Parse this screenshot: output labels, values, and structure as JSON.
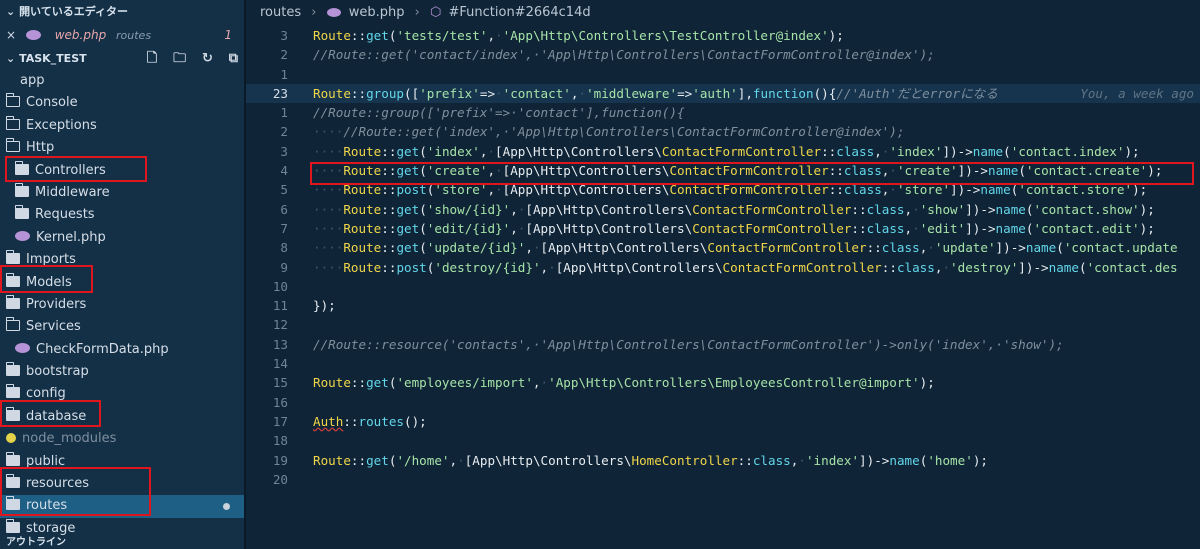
{
  "sidebar": {
    "open_editors_label": "開いているエディター",
    "open_editor": {
      "close": "×",
      "file": "web.php",
      "dir": "routes",
      "count": "1"
    },
    "project_label": "TASK_TEST",
    "tree": [
      {
        "label": "app",
        "level": 0,
        "type": "none"
      },
      {
        "label": "Console",
        "level": 1,
        "type": "folder"
      },
      {
        "label": "Exceptions",
        "level": 1,
        "type": "folder"
      },
      {
        "label": "Http",
        "level": 1,
        "type": "folder-open"
      },
      {
        "label": "Controllers",
        "level": 2,
        "type": "folder-filled"
      },
      {
        "label": "Middleware",
        "level": 2,
        "type": "folder-filled"
      },
      {
        "label": "Requests",
        "level": 2,
        "type": "folder-filled"
      },
      {
        "label": "Kernel.php",
        "level": 2,
        "type": "php"
      },
      {
        "label": "Imports",
        "level": 1,
        "type": "folder-filled"
      },
      {
        "label": "Models",
        "level": 1,
        "type": "folder-filled"
      },
      {
        "label": "Providers",
        "level": 1,
        "type": "folder-filled"
      },
      {
        "label": "Services",
        "level": 1,
        "type": "folder"
      },
      {
        "label": "CheckFormData.php",
        "level": 2,
        "type": "php"
      },
      {
        "label": "bootstrap",
        "level": 0,
        "type": "folder-filled"
      },
      {
        "label": "config",
        "level": 0,
        "type": "folder-filled"
      },
      {
        "label": "database",
        "level": 0,
        "type": "folder-filled"
      },
      {
        "label": "node_modules",
        "level": 0,
        "type": "node",
        "muted": true
      },
      {
        "label": "public",
        "level": 0,
        "type": "folder-filled"
      },
      {
        "label": "resources",
        "level": 0,
        "type": "folder-filled"
      },
      {
        "label": "routes",
        "level": 0,
        "type": "folder-filled",
        "active": true
      },
      {
        "label": "storage",
        "level": 0,
        "type": "folder-filled"
      }
    ],
    "outline_label": "アウトライン"
  },
  "breadcrumb": {
    "folder": "routes",
    "file": "web.php",
    "symbol": "#Function#2664c14d"
  },
  "code": {
    "blame": "You, a week ago",
    "lines": [
      {
        "n": "3",
        "segs": [
          [
            "y",
            "Route"
          ],
          [
            "w",
            "::"
          ],
          [
            "c",
            "get"
          ],
          [
            "w",
            "("
          ],
          [
            "s",
            "'tests/test'"
          ],
          [
            "w",
            ","
          ],
          [
            "x",
            "·"
          ],
          [
            "s",
            "'App\\Http\\Controllers\\TestController@index'"
          ],
          [
            "w",
            ");"
          ]
        ]
      },
      {
        "n": "2",
        "segs": [
          [
            "m",
            "//Route::get('contact/index',·'App\\Http\\Controllers\\ContactFormController@index');"
          ]
        ]
      },
      {
        "n": "1",
        "segs": []
      },
      {
        "n": "23",
        "current": true,
        "blame": true,
        "segs": [
          [
            "y",
            "Route"
          ],
          [
            "w",
            "::"
          ],
          [
            "c",
            "group"
          ],
          [
            "w",
            "(["
          ],
          [
            "s",
            "'prefix'"
          ],
          [
            "w",
            "=>"
          ],
          [
            "x",
            "·"
          ],
          [
            "s",
            "'contact'"
          ],
          [
            "w",
            ","
          ],
          [
            "x",
            "·"
          ],
          [
            "s",
            "'middleware'"
          ],
          [
            "w",
            "=>"
          ],
          [
            "s",
            "'auth'"
          ],
          [
            "w",
            "],"
          ],
          [
            "c",
            "function"
          ],
          [
            "w",
            "(){"
          ],
          [
            "m",
            "//'Auth'だとerrorになる"
          ]
        ]
      },
      {
        "n": "1",
        "segs": [
          [
            "m",
            "//Route::group(['prefix'=>·'contact'],function(){"
          ]
        ]
      },
      {
        "n": "2",
        "segs": [
          [
            "x",
            "····"
          ],
          [
            "m",
            "//Route::get('index',·'App\\Http\\Controllers\\ContactFormController@index');"
          ]
        ]
      },
      {
        "n": "3",
        "segs": [
          [
            "x",
            "····"
          ],
          [
            "y",
            "Route"
          ],
          [
            "w",
            "::"
          ],
          [
            "c",
            "get"
          ],
          [
            "w",
            "("
          ],
          [
            "s",
            "'index'"
          ],
          [
            "w",
            ","
          ],
          [
            "x",
            "·"
          ],
          [
            "w",
            "[App\\Http\\Controllers\\"
          ],
          [
            "y",
            "ContactFormController"
          ],
          [
            "w",
            "::"
          ],
          [
            "c",
            "class"
          ],
          [
            "w",
            ","
          ],
          [
            "x",
            "·"
          ],
          [
            "s",
            "'index'"
          ],
          [
            "w",
            "])->"
          ],
          [
            "c",
            "name"
          ],
          [
            "w",
            "("
          ],
          [
            "s",
            "'contact.index'"
          ],
          [
            "w",
            ");"
          ]
        ]
      },
      {
        "n": "4",
        "segs": [
          [
            "x",
            "····"
          ],
          [
            "y",
            "Route"
          ],
          [
            "w",
            "::"
          ],
          [
            "c",
            "get"
          ],
          [
            "w",
            "("
          ],
          [
            "s",
            "'create'"
          ],
          [
            "w",
            ","
          ],
          [
            "x",
            "·"
          ],
          [
            "w",
            "[App\\Http\\Controllers\\"
          ],
          [
            "y",
            "ContactFormController"
          ],
          [
            "w",
            "::"
          ],
          [
            "c",
            "class"
          ],
          [
            "w",
            ","
          ],
          [
            "x",
            "·"
          ],
          [
            "s",
            "'create'"
          ],
          [
            "w",
            "])->"
          ],
          [
            "c",
            "name"
          ],
          [
            "w",
            "("
          ],
          [
            "s",
            "'contact.create'"
          ],
          [
            "w",
            ");"
          ]
        ]
      },
      {
        "n": "5",
        "segs": [
          [
            "x",
            "····"
          ],
          [
            "y",
            "Route"
          ],
          [
            "w",
            "::"
          ],
          [
            "c",
            "post"
          ],
          [
            "w",
            "("
          ],
          [
            "s",
            "'store'"
          ],
          [
            "w",
            ","
          ],
          [
            "x",
            "·"
          ],
          [
            "w",
            "[App\\Http\\Controllers\\"
          ],
          [
            "y",
            "ContactFormController"
          ],
          [
            "w",
            "::"
          ],
          [
            "c",
            "class"
          ],
          [
            "w",
            ","
          ],
          [
            "x",
            "·"
          ],
          [
            "s",
            "'store'"
          ],
          [
            "w",
            "])->"
          ],
          [
            "c",
            "name"
          ],
          [
            "w",
            "("
          ],
          [
            "s",
            "'contact.store'"
          ],
          [
            "w",
            ");"
          ]
        ]
      },
      {
        "n": "6",
        "segs": [
          [
            "x",
            "····"
          ],
          [
            "y",
            "Route"
          ],
          [
            "w",
            "::"
          ],
          [
            "c",
            "get"
          ],
          [
            "w",
            "("
          ],
          [
            "s",
            "'show/{id}'"
          ],
          [
            "w",
            ","
          ],
          [
            "x",
            "·"
          ],
          [
            "w",
            "[App\\Http\\Controllers\\"
          ],
          [
            "y",
            "ContactFormController"
          ],
          [
            "w",
            "::"
          ],
          [
            "c",
            "class"
          ],
          [
            "w",
            ","
          ],
          [
            "x",
            "·"
          ],
          [
            "s",
            "'show'"
          ],
          [
            "w",
            "])->"
          ],
          [
            "c",
            "name"
          ],
          [
            "w",
            "("
          ],
          [
            "s",
            "'contact.show'"
          ],
          [
            "w",
            ");"
          ]
        ]
      },
      {
        "n": "7",
        "segs": [
          [
            "x",
            "····"
          ],
          [
            "y",
            "Route"
          ],
          [
            "w",
            "::"
          ],
          [
            "c",
            "get"
          ],
          [
            "w",
            "("
          ],
          [
            "s",
            "'edit/{id}'"
          ],
          [
            "w",
            ","
          ],
          [
            "x",
            "·"
          ],
          [
            "w",
            "[App\\Http\\Controllers\\"
          ],
          [
            "y",
            "ContactFormController"
          ],
          [
            "w",
            "::"
          ],
          [
            "c",
            "class"
          ],
          [
            "w",
            ","
          ],
          [
            "x",
            "·"
          ],
          [
            "s",
            "'edit'"
          ],
          [
            "w",
            "])->"
          ],
          [
            "c",
            "name"
          ],
          [
            "w",
            "("
          ],
          [
            "s",
            "'contact.edit'"
          ],
          [
            "w",
            ");"
          ]
        ]
      },
      {
        "n": "8",
        "segs": [
          [
            "x",
            "····"
          ],
          [
            "y",
            "Route"
          ],
          [
            "w",
            "::"
          ],
          [
            "c",
            "get"
          ],
          [
            "w",
            "("
          ],
          [
            "s",
            "'update/{id}'"
          ],
          [
            "w",
            ","
          ],
          [
            "x",
            "·"
          ],
          [
            "w",
            "[App\\Http\\Controllers\\"
          ],
          [
            "y",
            "ContactFormController"
          ],
          [
            "w",
            "::"
          ],
          [
            "c",
            "class"
          ],
          [
            "w",
            ","
          ],
          [
            "x",
            "·"
          ],
          [
            "s",
            "'update'"
          ],
          [
            "w",
            "])->"
          ],
          [
            "c",
            "name"
          ],
          [
            "w",
            "("
          ],
          [
            "s",
            "'contact.update"
          ]
        ]
      },
      {
        "n": "9",
        "segs": [
          [
            "x",
            "····"
          ],
          [
            "y",
            "Route"
          ],
          [
            "w",
            "::"
          ],
          [
            "c",
            "post"
          ],
          [
            "w",
            "("
          ],
          [
            "s",
            "'destroy/{id}'"
          ],
          [
            "w",
            ","
          ],
          [
            "x",
            "·"
          ],
          [
            "w",
            "[App\\Http\\Controllers\\"
          ],
          [
            "y",
            "ContactFormController"
          ],
          [
            "w",
            "::"
          ],
          [
            "c",
            "class"
          ],
          [
            "w",
            ","
          ],
          [
            "x",
            "·"
          ],
          [
            "s",
            "'destroy'"
          ],
          [
            "w",
            "])->"
          ],
          [
            "c",
            "name"
          ],
          [
            "w",
            "("
          ],
          [
            "s",
            "'contact.des"
          ]
        ]
      },
      {
        "n": "10",
        "segs": []
      },
      {
        "n": "11",
        "segs": [
          [
            "w",
            "});"
          ]
        ]
      },
      {
        "n": "12",
        "segs": []
      },
      {
        "n": "13",
        "segs": [
          [
            "m",
            "//Route::resource('contacts',·'App\\Http\\Controllers\\ContactFormController')->only('index',·'show');"
          ]
        ]
      },
      {
        "n": "14",
        "segs": []
      },
      {
        "n": "15",
        "segs": [
          [
            "y",
            "Route"
          ],
          [
            "w",
            "::"
          ],
          [
            "c",
            "get"
          ],
          [
            "w",
            "("
          ],
          [
            "s",
            "'employees/import'"
          ],
          [
            "w",
            ","
          ],
          [
            "x",
            "·"
          ],
          [
            "s",
            "'App\\Http\\Controllers\\EmployeesController@import'"
          ],
          [
            "w",
            ");"
          ]
        ]
      },
      {
        "n": "16",
        "segs": []
      },
      {
        "n": "17",
        "segs": [
          [
            "q",
            "Auth"
          ],
          [
            "w",
            "::"
          ],
          [
            "c",
            "routes"
          ],
          [
            "w",
            "();"
          ]
        ]
      },
      {
        "n": "18",
        "segs": []
      },
      {
        "n": "19",
        "segs": [
          [
            "y",
            "Route"
          ],
          [
            "w",
            "::"
          ],
          [
            "c",
            "get"
          ],
          [
            "w",
            "("
          ],
          [
            "s",
            "'/home'"
          ],
          [
            "w",
            ","
          ],
          [
            "x",
            "·"
          ],
          [
            "w",
            "[App\\Http\\Controllers\\"
          ],
          [
            "y",
            "HomeController"
          ],
          [
            "w",
            "::"
          ],
          [
            "c",
            "class"
          ],
          [
            "w",
            ","
          ],
          [
            "x",
            "·"
          ],
          [
            "s",
            "'index'"
          ],
          [
            "w",
            "])->"
          ],
          [
            "c",
            "name"
          ],
          [
            "w",
            "("
          ],
          [
            "s",
            "'home'"
          ],
          [
            "w",
            ");"
          ]
        ]
      },
      {
        "n": "20",
        "segs": []
      }
    ]
  },
  "colors": {
    "highlight_box": "#e0161f",
    "sidebar_bg": "#133047",
    "editor_bg": "#0f2436",
    "active_row": "#1e5f86"
  }
}
